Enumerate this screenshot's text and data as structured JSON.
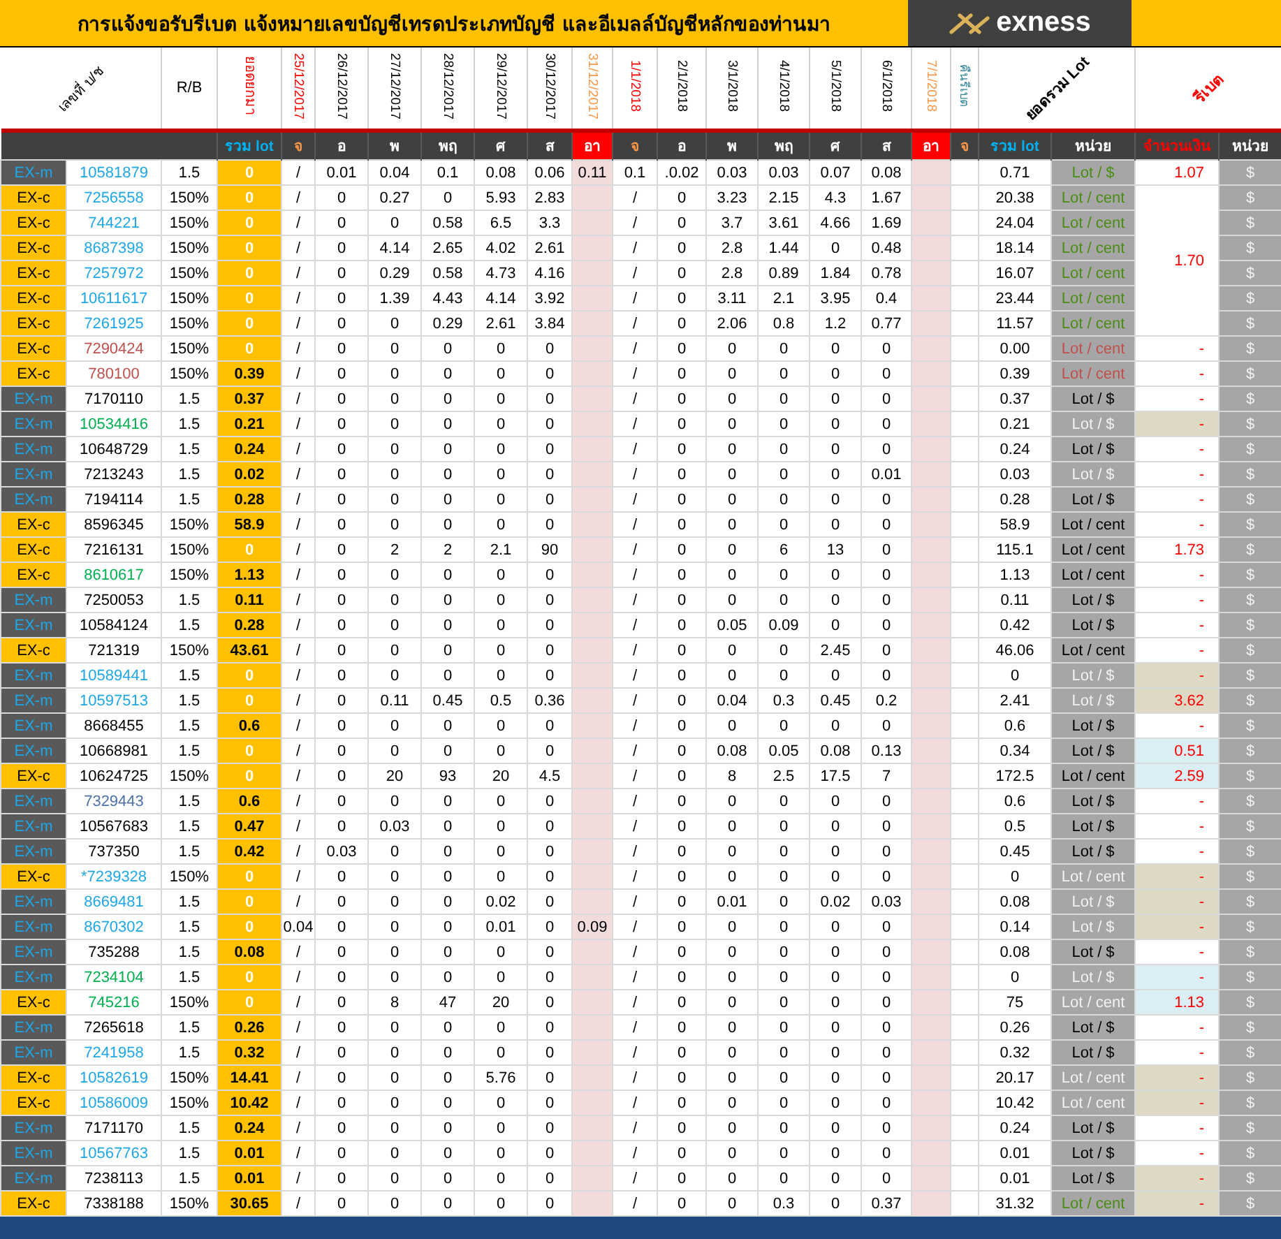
{
  "title": "การแจ้งขอรับรีเบต   แจ้งหมายเลขบัญชีเทรดประเภทบัญชี และอีเมลล์บัญชีหลักของท่านมา",
  "logo": "exness",
  "columns": {
    "account": "เลขที่ บ/ช",
    "rb": "R/B",
    "carried": "ยอดยกมา",
    "refund": "คืนรีเบต",
    "total": "ยอดรวม Lot",
    "rebate": "รีเบต",
    "days": [
      {
        "date": "25/12/2017",
        "day": "จ",
        "color": "#ff0000",
        "sunday": false
      },
      {
        "date": "26/12/2017",
        "day": "อ",
        "color": "#000000",
        "sunday": false
      },
      {
        "date": "27/12/2017",
        "day": "พ",
        "color": "#000000",
        "sunday": false
      },
      {
        "date": "28/12/2017",
        "day": "พฤ",
        "color": "#000000",
        "sunday": false
      },
      {
        "date": "29/12/2017",
        "day": "ศ",
        "color": "#000000",
        "sunday": false
      },
      {
        "date": "30/12/2017",
        "day": "ส",
        "color": "#000000",
        "sunday": false
      },
      {
        "date": "31/12/2017",
        "day": "อา",
        "color": "#f79646",
        "sunday": true
      },
      {
        "date": "1/1/2018",
        "day": "จ",
        "color": "#ff0000",
        "sunday": false
      },
      {
        "date": "2/1/2018",
        "day": "อ",
        "color": "#000000",
        "sunday": false
      },
      {
        "date": "3/1/2018",
        "day": "พ",
        "color": "#000000",
        "sunday": false
      },
      {
        "date": "4/1/2018",
        "day": "พฤ",
        "color": "#000000",
        "sunday": false
      },
      {
        "date": "5/1/2018",
        "day": "ศ",
        "color": "#000000",
        "sunday": false
      },
      {
        "date": "6/1/2018",
        "day": "ส",
        "color": "#000000",
        "sunday": false
      },
      {
        "date": "7/1/2018",
        "day": "อา",
        "color": "#f79646",
        "sunday": true
      }
    ]
  },
  "subheader": {
    "carried": "รวม lot",
    "refund_day": "จ",
    "total": "รวม lot",
    "unit": "หน่วย",
    "amount": "จำนวนเงิน",
    "currency_unit": "หน่วย"
  },
  "rows": [
    {
      "kind": "m",
      "type": "EX-m",
      "account": {
        "text": "10581879",
        "color": "#1ea7e8"
      },
      "rb": "1.5",
      "carried": "0",
      "carried_muted": true,
      "week1": [
        "/",
        "0.01",
        "0.04",
        "0.1",
        "0.08",
        "0.06"
      ],
      "sunday1": "0.11",
      "week2": [
        "0.1",
        ".0.02",
        "0.03",
        "0.03",
        "0.07",
        "0.08"
      ],
      "total": "0.71",
      "unit": {
        "text": "Lot / $",
        "color": "#4a8c14"
      },
      "rebate": {
        "text": "1.07",
        "color": "#ffffff"
      },
      "currency": "$"
    },
    {
      "kind": "c",
      "type": "EX-c",
      "account": {
        "text": "7256558",
        "color": "#1ea7e8"
      },
      "rb": "150%",
      "carried": "0",
      "carried_muted": true,
      "week1": [
        "/",
        "0",
        "0.27",
        "0",
        "5.93",
        "2.83"
      ],
      "week2": [
        "/",
        "0",
        "3.23",
        "2.15",
        "4.3",
        "1.67"
      ],
      "total": "20.38",
      "unit": {
        "text": "Lot / cent",
        "color": "#4a8c14"
      },
      "rebate": {
        "text": "1.70",
        "color": "#ffffff"
      },
      "currency": "$"
    },
    {
      "kind": "c",
      "type": "EX-c",
      "account": {
        "text": "744221",
        "color": "#1ea7e8"
      },
      "rb": "150%",
      "carried": "0",
      "carried_muted": true,
      "week1": [
        "/",
        "0",
        "0",
        "0.58",
        "6.5",
        "3.3"
      ],
      "week2": [
        "/",
        "0",
        "3.7",
        "3.61",
        "4.66",
        "1.69"
      ],
      "total": "24.04",
      "unit": {
        "text": "Lot / cent",
        "color": "#4a8c14"
      },
      "currency": "$"
    },
    {
      "kind": "c",
      "type": "EX-c",
      "account": {
        "text": "8687398",
        "color": "#1ea7e8"
      },
      "rb": "150%",
      "carried": "0",
      "carried_muted": true,
      "week1": [
        "/",
        "0",
        "4.14",
        "2.65",
        "4.02",
        "2.61"
      ],
      "week2": [
        "/",
        "0",
        "2.8",
        "1.44",
        "0",
        "0.48"
      ],
      "total": "18.14",
      "unit": {
        "text": "Lot / cent",
        "color": "#4a8c14"
      },
      "currency": "$"
    },
    {
      "kind": "c",
      "type": "EX-c",
      "account": {
        "text": "7257972",
        "color": "#1ea7e8"
      },
      "rb": "150%",
      "carried": "0",
      "carried_muted": true,
      "week1": [
        "/",
        "0",
        "0.29",
        "0.58",
        "4.73",
        "4.16"
      ],
      "week2": [
        "/",
        "0",
        "2.8",
        "0.89",
        "1.84",
        "0.78"
      ],
      "total": "16.07",
      "unit": {
        "text": "Lot / cent",
        "color": "#4a8c14"
      },
      "currency": "$"
    },
    {
      "kind": "c",
      "type": "EX-c",
      "account": {
        "text": "10611617",
        "color": "#1ea7e8"
      },
      "rb": "150%",
      "carried": "0",
      "carried_muted": true,
      "week1": [
        "/",
        "0",
        "1.39",
        "4.43",
        "4.14",
        "3.92"
      ],
      "week2": [
        "/",
        "0",
        "3.11",
        "2.1",
        "3.95",
        "0.4"
      ],
      "total": "23.44",
      "unit": {
        "text": "Lot / cent",
        "color": "#4a8c14"
      },
      "currency": "$"
    },
    {
      "kind": "c",
      "type": "EX-c",
      "account": {
        "text": "7261925",
        "color": "#1ea7e8"
      },
      "rb": "150%",
      "carried": "0",
      "carried_muted": true,
      "week1": [
        "/",
        "0",
        "0",
        "0.29",
        "2.61",
        "3.84"
      ],
      "week2": [
        "/",
        "0",
        "2.06",
        "0.8",
        "1.2",
        "0.77"
      ],
      "total": "11.57",
      "unit": {
        "text": "Lot / cent",
        "color": "#4a8c14"
      },
      "currency": "$"
    },
    {
      "kind": "c",
      "type": "EX-c",
      "account": {
        "text": "7290424",
        "color": "#c0504d"
      },
      "rb": "150%",
      "carried": "0",
      "carried_muted": true,
      "week1": [
        "/",
        "0",
        "0",
        "0",
        "0",
        "0"
      ],
      "week2": [
        "/",
        "0",
        "0",
        "0",
        "0",
        "0"
      ],
      "total": "0.00",
      "unit": {
        "text": "Lot / cent",
        "color": "#c0504d"
      },
      "rebate": {
        "text": "-",
        "color": "#ffffff"
      },
      "currency": "$"
    },
    {
      "kind": "c",
      "type": "EX-c",
      "account": {
        "text": "780100",
        "color": "#c0504d"
      },
      "rb": "150%",
      "carried": "0.39",
      "carried_muted": false,
      "week1": [
        "/",
        "0",
        "0",
        "0",
        "0",
        "0"
      ],
      "week2": [
        "/",
        "0",
        "0",
        "0",
        "0",
        "0"
      ],
      "total": "0.39",
      "unit": {
        "text": "Lot / cent",
        "color": "#c0504d"
      },
      "rebate": {
        "text": "-",
        "color": "#ffffff"
      },
      "currency": "$"
    },
    {
      "kind": "m",
      "type": "EX-m",
      "account": {
        "text": "7170110",
        "color": "#000000"
      },
      "rb": "1.5",
      "carried": "0.37",
      "carried_muted": false,
      "week1": [
        "/",
        "0",
        "0",
        "0",
        "0",
        "0"
      ],
      "week2": [
        "/",
        "0",
        "0",
        "0",
        "0",
        "0"
      ],
      "total": "0.37",
      "unit": {
        "text": "Lot / $",
        "color": "#000000"
      },
      "rebate": {
        "text": "-",
        "color": "#ffffff"
      },
      "currency": "$"
    },
    {
      "kind": "m",
      "type": "EX-m",
      "account": {
        "text": "10534416",
        "color": "#00b050"
      },
      "rb": "1.5",
      "carried": "0.21",
      "carried_muted": false,
      "week1": [
        "/",
        "0",
        "0",
        "0",
        "0",
        "0"
      ],
      "week2": [
        "/",
        "0",
        "0",
        "0",
        "0",
        "0"
      ],
      "total": "0.21",
      "unit": {
        "text": "Lot / $",
        "color": "#f2f2f2"
      },
      "rebate": {
        "text": "-",
        "color": "#ddd9c4"
      },
      "currency": "$"
    },
    {
      "kind": "m",
      "type": "EX-m",
      "account": {
        "text": "10648729",
        "color": "#000000"
      },
      "rb": "1.5",
      "carried": "0.24",
      "carried_muted": false,
      "week1": [
        "/",
        "0",
        "0",
        "0",
        "0",
        "0"
      ],
      "week2": [
        "/",
        "0",
        "0",
        "0",
        "0",
        "0"
      ],
      "total": "0.24",
      "unit": {
        "text": "Lot / $",
        "color": "#000000"
      },
      "rebate": {
        "text": "-",
        "color": "#ffffff"
      },
      "currency": "$"
    },
    {
      "kind": "m",
      "type": "EX-m",
      "account": {
        "text": "7213243",
        "color": "#000000"
      },
      "rb": "1.5",
      "carried": "0.02",
      "carried_muted": false,
      "week1": [
        "/",
        "0",
        "0",
        "0",
        "0",
        "0"
      ],
      "week2": [
        "/",
        "0",
        "0",
        "0",
        "0",
        "0.01"
      ],
      "total": "0.03",
      "unit": {
        "text": "Lot / $",
        "color": "#f2f2f2"
      },
      "rebate": {
        "text": "-",
        "color": "#ffffff"
      },
      "currency": "$"
    },
    {
      "kind": "m",
      "type": "EX-m",
      "account": {
        "text": "7194114",
        "color": "#000000"
      },
      "rb": "1.5",
      "carried": "0.28",
      "carried_muted": false,
      "week1": [
        "/",
        "0",
        "0",
        "0",
        "0",
        "0"
      ],
      "week2": [
        "/",
        "0",
        "0",
        "0",
        "0",
        "0"
      ],
      "total": "0.28",
      "unit": {
        "text": "Lot / $",
        "color": "#000000"
      },
      "rebate": {
        "text": "-",
        "color": "#ffffff"
      },
      "currency": "$"
    },
    {
      "kind": "c",
      "type": "EX-c",
      "account": {
        "text": "8596345",
        "color": "#000000"
      },
      "rb": "150%",
      "carried": "58.9",
      "carried_muted": false,
      "week1": [
        "/",
        "0",
        "0",
        "0",
        "0",
        "0"
      ],
      "week2": [
        "/",
        "0",
        "0",
        "0",
        "0",
        "0"
      ],
      "total": "58.9",
      "unit": {
        "text": "Lot / cent",
        "color": "#000000"
      },
      "rebate": {
        "text": "-",
        "color": "#ffffff"
      },
      "currency": "$"
    },
    {
      "kind": "c",
      "type": "EX-c",
      "account": {
        "text": "7216131",
        "color": "#000000"
      },
      "rb": "150%",
      "carried": "0",
      "carried_muted": true,
      "week1": [
        "/",
        "0",
        "2",
        "2",
        "2.1",
        "90"
      ],
      "week2": [
        "/",
        "0",
        "0",
        "6",
        "13",
        "0"
      ],
      "total": "115.1",
      "unit": {
        "text": "Lot / cent",
        "color": "#000000"
      },
      "rebate": {
        "text": "1.73",
        "color": "#ffffff"
      },
      "currency": "$"
    },
    {
      "kind": "c",
      "type": "EX-c",
      "account": {
        "text": "8610617",
        "color": "#00b050"
      },
      "rb": "150%",
      "carried": "1.13",
      "carried_muted": false,
      "week1": [
        "/",
        "0",
        "0",
        "0",
        "0",
        "0"
      ],
      "week2": [
        "/",
        "0",
        "0",
        "0",
        "0",
        "0"
      ],
      "total": "1.13",
      "unit": {
        "text": "Lot / cent",
        "color": "#000000"
      },
      "rebate": {
        "text": "-",
        "color": "#ffffff"
      },
      "currency": "$"
    },
    {
      "kind": "m",
      "type": "EX-m",
      "account": {
        "text": "7250053",
        "color": "#000000"
      },
      "rb": "1.5",
      "carried": "0.11",
      "carried_muted": false,
      "week1": [
        "/",
        "0",
        "0",
        "0",
        "0",
        "0"
      ],
      "week2": [
        "/",
        "0",
        "0",
        "0",
        "0",
        "0"
      ],
      "total": "0.11",
      "unit": {
        "text": "Lot / $",
        "color": "#000000"
      },
      "rebate": {
        "text": "-",
        "color": "#ffffff"
      },
      "currency": "$"
    },
    {
      "kind": "m",
      "type": "EX-m",
      "account": {
        "text": "10584124",
        "color": "#000000"
      },
      "rb": "1.5",
      "carried": "0.28",
      "carried_muted": false,
      "week1": [
        "/",
        "0",
        "0",
        "0",
        "0",
        "0"
      ],
      "week2": [
        "/",
        "0",
        "0.05",
        "0.09",
        "0",
        "0"
      ],
      "total": "0.42",
      "unit": {
        "text": "Lot / $",
        "color": "#000000"
      },
      "rebate": {
        "text": "-",
        "color": "#ffffff"
      },
      "currency": "$"
    },
    {
      "kind": "c",
      "type": "EX-c",
      "account": {
        "text": "721319",
        "color": "#000000"
      },
      "rb": "150%",
      "carried": "43.61",
      "carried_muted": false,
      "week1": [
        "/",
        "0",
        "0",
        "0",
        "0",
        "0"
      ],
      "week2": [
        "/",
        "0",
        "0",
        "0",
        "2.45",
        "0"
      ],
      "total": "46.06",
      "unit": {
        "text": "Lot / cent",
        "color": "#000000"
      },
      "rebate": {
        "text": "-",
        "color": "#ffffff"
      },
      "currency": "$"
    },
    {
      "kind": "m",
      "type": "EX-m",
      "account": {
        "text": "10589441",
        "color": "#1ea7e8"
      },
      "rb": "1.5",
      "carried": "0",
      "carried_muted": true,
      "week1": [
        "/",
        "0",
        "0",
        "0",
        "0",
        "0"
      ],
      "week2": [
        "/",
        "0",
        "0",
        "0",
        "0",
        "0"
      ],
      "total": "0",
      "unit": {
        "text": "Lot / $",
        "color": "#f2f2f2"
      },
      "rebate": {
        "text": "-",
        "color": "#ddd9c4"
      },
      "currency": "$"
    },
    {
      "kind": "m",
      "type": "EX-m",
      "account": {
        "text": "10597513",
        "color": "#1ea7e8"
      },
      "rb": "1.5",
      "carried": "0",
      "carried_muted": true,
      "week1": [
        "/",
        "0",
        "0.11",
        "0.45",
        "0.5",
        "0.36"
      ],
      "week2": [
        "/",
        "0",
        "0.04",
        "0.3",
        "0.45",
        "0.2"
      ],
      "total": "2.41",
      "unit": {
        "text": "Lot / $",
        "color": "#f2f2f2"
      },
      "rebate": {
        "text": "3.62",
        "color": "#ddd9c4"
      },
      "currency": "$"
    },
    {
      "kind": "m",
      "type": "EX-m",
      "account": {
        "text": "8668455",
        "color": "#000000"
      },
      "rb": "1.5",
      "carried": "0.6",
      "carried_muted": false,
      "week1": [
        "/",
        "0",
        "0",
        "0",
        "0",
        "0"
      ],
      "week2": [
        "/",
        "0",
        "0",
        "0",
        "0",
        "0"
      ],
      "total": "0.6",
      "unit": {
        "text": "Lot / $",
        "color": "#000000"
      },
      "rebate": {
        "text": "-",
        "color": "#ffffff"
      },
      "currency": "$"
    },
    {
      "kind": "m",
      "type": "EX-m",
      "account": {
        "text": "10668981",
        "color": "#000000"
      },
      "rb": "1.5",
      "carried": "0",
      "carried_muted": true,
      "week1": [
        "/",
        "0",
        "0",
        "0",
        "0",
        "0"
      ],
      "week2": [
        "/",
        "0",
        "0.08",
        "0.05",
        "0.08",
        "0.13"
      ],
      "total": "0.34",
      "unit": {
        "text": "Lot / $",
        "color": "#000000"
      },
      "rebate": {
        "text": "0.51",
        "color": "#daeef3"
      },
      "currency": "$"
    },
    {
      "kind": "c",
      "type": "EX-c",
      "account": {
        "text": "10624725",
        "color": "#000000"
      },
      "rb": "150%",
      "carried": "0",
      "carried_muted": true,
      "week1": [
        "/",
        "0",
        "20",
        "93",
        "20",
        "4.5"
      ],
      "week2": [
        "/",
        "0",
        "8",
        "2.5",
        "17.5",
        "7"
      ],
      "total": "172.5",
      "unit": {
        "text": "Lot / cent",
        "color": "#000000"
      },
      "rebate": {
        "text": "2.59",
        "color": "#daeef3"
      },
      "currency": "$"
    },
    {
      "kind": "m",
      "type": "EX-m",
      "account": {
        "text": "7329443",
        "color": "#4f6fa8"
      },
      "rb": "1.5",
      "carried": "0.6",
      "carried_muted": false,
      "week1": [
        "/",
        "0",
        "0",
        "0",
        "0",
        "0"
      ],
      "week2": [
        "/",
        "0",
        "0",
        "0",
        "0",
        "0"
      ],
      "total": "0.6",
      "unit": {
        "text": "Lot / $",
        "color": "#000000"
      },
      "rebate": {
        "text": "-",
        "color": "#ffffff"
      },
      "currency": "$"
    },
    {
      "kind": "m",
      "type": "EX-m",
      "account": {
        "text": "10567683",
        "color": "#000000"
      },
      "rb": "1.5",
      "carried": "0.47",
      "carried_muted": false,
      "week1": [
        "/",
        "0",
        "0.03",
        "0",
        "0",
        "0"
      ],
      "week2": [
        "/",
        "0",
        "0",
        "0",
        "0",
        "0"
      ],
      "total": "0.5",
      "unit": {
        "text": "Lot / $",
        "color": "#000000"
      },
      "rebate": {
        "text": "-",
        "color": "#ffffff"
      },
      "currency": "$"
    },
    {
      "kind": "m",
      "type": "EX-m",
      "account": {
        "text": "737350",
        "color": "#000000"
      },
      "rb": "1.5",
      "carried": "0.42",
      "carried_muted": false,
      "week1": [
        "/",
        "0.03",
        "0",
        "0",
        "0",
        "0"
      ],
      "week2": [
        "/",
        "0",
        "0",
        "0",
        "0",
        "0"
      ],
      "total": "0.45",
      "unit": {
        "text": "Lot / $",
        "color": "#000000"
      },
      "rebate": {
        "text": "-",
        "color": "#ffffff"
      },
      "currency": "$"
    },
    {
      "kind": "c",
      "type": "EX-c",
      "account": {
        "text": "*7239328",
        "color": "#1ea7e8"
      },
      "rb": "150%",
      "carried": "0",
      "carried_muted": true,
      "week1": [
        "/",
        "0",
        "0",
        "0",
        "0",
        "0"
      ],
      "week2": [
        "/",
        "0",
        "0",
        "0",
        "0",
        "0"
      ],
      "total": "0",
      "unit": {
        "text": "Lot / cent",
        "color": "#f2f2f2"
      },
      "rebate": {
        "text": "-",
        "color": "#ddd9c4"
      },
      "currency": "$"
    },
    {
      "kind": "m",
      "type": "EX-m",
      "account": {
        "text": "8669481",
        "color": "#1ea7e8"
      },
      "rb": "1.5",
      "carried": "0",
      "carried_muted": true,
      "week1": [
        "/",
        "0",
        "0",
        "0",
        "0.02",
        "0"
      ],
      "week2": [
        "/",
        "0",
        "0.01",
        "0",
        "0.02",
        "0.03"
      ],
      "total": "0.08",
      "unit": {
        "text": "Lot / $",
        "color": "#f2f2f2"
      },
      "rebate": {
        "text": "-",
        "color": "#ddd9c4"
      },
      "currency": "$"
    },
    {
      "kind": "m",
      "type": "EX-m",
      "account": {
        "text": "8670302",
        "color": "#1ea7e8"
      },
      "rb": "1.5",
      "carried": "0",
      "carried_muted": true,
      "week1": [
        "0.04",
        "0",
        "0",
        "0",
        "0.01",
        "0"
      ],
      "sunday1": "0.09",
      "week2": [
        "/",
        "0",
        "0",
        "0",
        "0",
        "0"
      ],
      "total": "0.14",
      "unit": {
        "text": "Lot / $",
        "color": "#f2f2f2"
      },
      "rebate": {
        "text": "-",
        "color": "#ddd9c4"
      },
      "currency": "$"
    },
    {
      "kind": "m",
      "type": "EX-m",
      "account": {
        "text": "735288",
        "color": "#000000"
      },
      "rb": "1.5",
      "carried": "0.08",
      "carried_muted": false,
      "week1": [
        "/",
        "0",
        "0",
        "0",
        "0",
        "0"
      ],
      "week2": [
        "/",
        "0",
        "0",
        "0",
        "0",
        "0"
      ],
      "total": "0.08",
      "unit": {
        "text": "Lot / $",
        "color": "#000000"
      },
      "rebate": {
        "text": "-",
        "color": "#ffffff"
      },
      "currency": "$"
    },
    {
      "kind": "m",
      "type": "EX-m",
      "account": {
        "text": "7234104",
        "color": "#00b050"
      },
      "rb": "1.5",
      "carried": "0",
      "carried_muted": true,
      "week1": [
        "/",
        "0",
        "0",
        "0",
        "0",
        "0"
      ],
      "week2": [
        "/",
        "0",
        "0",
        "0",
        "0",
        "0"
      ],
      "total": "0",
      "unit": {
        "text": "Lot / $",
        "color": "#f2f2f2"
      },
      "rebate": {
        "text": "-",
        "color": "#daeef3"
      },
      "currency": "$"
    },
    {
      "kind": "c",
      "type": "EX-c",
      "account": {
        "text": "745216",
        "color": "#00b050"
      },
      "rb": "150%",
      "carried": "0",
      "carried_muted": true,
      "week1": [
        "/",
        "0",
        "8",
        "47",
        "20",
        "0"
      ],
      "week2": [
        "/",
        "0",
        "0",
        "0",
        "0",
        "0"
      ],
      "total": "75",
      "unit": {
        "text": "Lot / cent",
        "color": "#f2f2f2"
      },
      "rebate": {
        "text": "1.13",
        "color": "#daeef3"
      },
      "currency": "$"
    },
    {
      "kind": "m",
      "type": "EX-m",
      "account": {
        "text": "7265618",
        "color": "#000000"
      },
      "rb": "1.5",
      "carried": "0.26",
      "carried_muted": false,
      "week1": [
        "/",
        "0",
        "0",
        "0",
        "0",
        "0"
      ],
      "week2": [
        "/",
        "0",
        "0",
        "0",
        "0",
        "0"
      ],
      "total": "0.26",
      "unit": {
        "text": "Lot / $",
        "color": "#000000"
      },
      "rebate": {
        "text": "-",
        "color": "#ffffff"
      },
      "currency": "$"
    },
    {
      "kind": "m",
      "type": "EX-m",
      "account": {
        "text": "7241958",
        "color": "#1ea7e8"
      },
      "rb": "1.5",
      "carried": "0.32",
      "carried_muted": false,
      "week1": [
        "/",
        "0",
        "0",
        "0",
        "0",
        "0"
      ],
      "week2": [
        "/",
        "0",
        "0",
        "0",
        "0",
        "0"
      ],
      "total": "0.32",
      "unit": {
        "text": "Lot / $",
        "color": "#000000"
      },
      "rebate": {
        "text": "-",
        "color": "#ffffff"
      },
      "currency": "$"
    },
    {
      "kind": "c",
      "type": "EX-c",
      "account": {
        "text": "10582619",
        "color": "#1ea7e8"
      },
      "rb": "150%",
      "carried": "14.41",
      "carried_muted": false,
      "week1": [
        "/",
        "0",
        "0",
        "0",
        "5.76",
        "0"
      ],
      "week2": [
        "/",
        "0",
        "0",
        "0",
        "0",
        "0"
      ],
      "total": "20.17",
      "unit": {
        "text": "Lot / cent",
        "color": "#f2f2f2"
      },
      "rebate": {
        "text": "-",
        "color": "#ddd9c4"
      },
      "currency": "$"
    },
    {
      "kind": "c",
      "type": "EX-c",
      "account": {
        "text": "10586009",
        "color": "#1ea7e8"
      },
      "rb": "150%",
      "carried": "10.42",
      "carried_muted": false,
      "week1": [
        "/",
        "0",
        "0",
        "0",
        "0",
        "0"
      ],
      "week2": [
        "/",
        "0",
        "0",
        "0",
        "0",
        "0"
      ],
      "total": "10.42",
      "unit": {
        "text": "Lot / cent",
        "color": "#f2f2f2"
      },
      "rebate": {
        "text": "-",
        "color": "#ddd9c4"
      },
      "currency": "$"
    },
    {
      "kind": "m",
      "type": "EX-m",
      "account": {
        "text": "7171170",
        "color": "#000000"
      },
      "rb": "1.5",
      "carried": "0.24",
      "carried_muted": false,
      "week1": [
        "/",
        "0",
        "0",
        "0",
        "0",
        "0"
      ],
      "week2": [
        "/",
        "0",
        "0",
        "0",
        "0",
        "0"
      ],
      "total": "0.24",
      "unit": {
        "text": "Lot / $",
        "color": "#000000"
      },
      "rebate": {
        "text": "-",
        "color": "#ffffff"
      },
      "currency": "$"
    },
    {
      "kind": "m",
      "type": "EX-m",
      "account": {
        "text": "10567763",
        "color": "#1ea7e8"
      },
      "rb": "1.5",
      "carried": "0.01",
      "carried_muted": false,
      "week1": [
        "/",
        "0",
        "0",
        "0",
        "0",
        "0"
      ],
      "week2": [
        "/",
        "0",
        "0",
        "0",
        "0",
        "0"
      ],
      "total": "0.01",
      "unit": {
        "text": "Lot / $",
        "color": "#000000"
      },
      "rebate": {
        "text": "-",
        "color": "#ffffff"
      },
      "currency": "$"
    },
    {
      "kind": "m",
      "type": "EX-m",
      "account": {
        "text": "7238113",
        "color": "#000000"
      },
      "rb": "1.5",
      "carried": "0.01",
      "carried_muted": false,
      "week1": [
        "/",
        "0",
        "0",
        "0",
        "0",
        "0"
      ],
      "week2": [
        "/",
        "0",
        "0",
        "0",
        "0",
        "0"
      ],
      "total": "0.01",
      "unit": {
        "text": "Lot / $",
        "color": "#000000"
      },
      "rebate": {
        "text": "-",
        "color": "#ddd9c4"
      },
      "currency": "$"
    },
    {
      "kind": "c",
      "type": "EX-c",
      "account": {
        "text": "7338188",
        "color": "#000000"
      },
      "rb": "150%",
      "carried": "30.65",
      "carried_muted": false,
      "week1": [
        "/",
        "0",
        "0",
        "0",
        "0",
        "0"
      ],
      "week2": [
        "/",
        "0",
        "0",
        "0.3",
        "0",
        "0.37"
      ],
      "total": "31.32",
      "unit": {
        "text": "Lot / cent",
        "color": "#4a8c14"
      },
      "rebate": {
        "text": "-",
        "color": "#ddd9c4"
      },
      "currency": "$"
    }
  ]
}
